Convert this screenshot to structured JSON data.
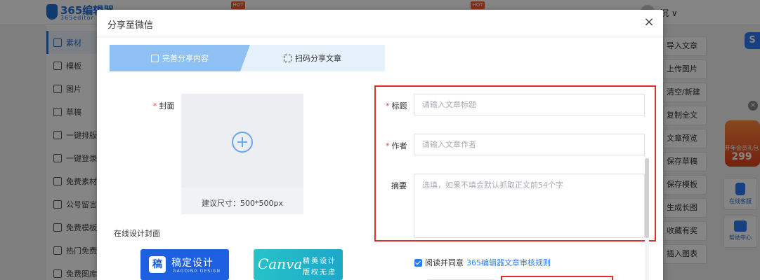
{
  "app": {
    "logo_title": "365编辑器",
    "logo_sub": "365editor",
    "hot_badge": "HOT",
    "user_name": "沉 ∨"
  },
  "left_nav": {
    "items": [
      {
        "label": "素材"
      },
      {
        "label": "模板"
      },
      {
        "label": "图片"
      },
      {
        "label": "草稿"
      },
      {
        "label": "一键排版"
      },
      {
        "label": "一键登录"
      },
      {
        "label": "免费素材"
      },
      {
        "label": "公号留言"
      },
      {
        "label": "免费模板"
      },
      {
        "label": "热门免费"
      },
      {
        "label": "免费图库"
      }
    ]
  },
  "right_tools": {
    "items": [
      {
        "label": "导入文章"
      },
      {
        "label": "上传图片"
      },
      {
        "label": "清空/新建"
      },
      {
        "label": "复制全文"
      },
      {
        "label": "文章预览"
      },
      {
        "label": "保存草稿"
      },
      {
        "label": "保存模板"
      },
      {
        "label": "生成长图"
      },
      {
        "label": "收藏有奖"
      },
      {
        "label": "插入图表"
      }
    ],
    "promo_text": "开年会员礼包",
    "promo_price": "299",
    "service_label": "在线客服",
    "help_label": "帮助中心",
    "chat_icon": "S"
  },
  "modal": {
    "title": "分享至微信",
    "close": "×",
    "steps": [
      {
        "label": "完善分享内容"
      },
      {
        "label": "扫码分享文章"
      }
    ],
    "cover": {
      "label": "封面",
      "hint": "建议尺寸：500*500px"
    },
    "design": {
      "title": "在线设计封面",
      "gaoding": {
        "mark": "稿",
        "name": "稿定设计",
        "sub": "GAODING DESIGN"
      },
      "canva": {
        "name": "Canva",
        "line1": "精美设计",
        "line2": "版权无虑"
      }
    },
    "form": {
      "title_label": "标题",
      "title_placeholder": "请输入文章标题",
      "author_label": "作者",
      "author_placeholder": "请输入文章作者",
      "summary_label": "摘要",
      "summary_placeholder": "选填，如果不填会默认抓取正文前54个字"
    },
    "agree": {
      "text": "阅读并同意",
      "link": "365编辑器文章审核规则"
    }
  },
  "colors": {
    "accent": "#2d7cf6",
    "step_active": "#8ec0f4",
    "step_inactive": "#e6f1fc",
    "highlight_border": "#d8322a",
    "required": "#e24b3b"
  }
}
